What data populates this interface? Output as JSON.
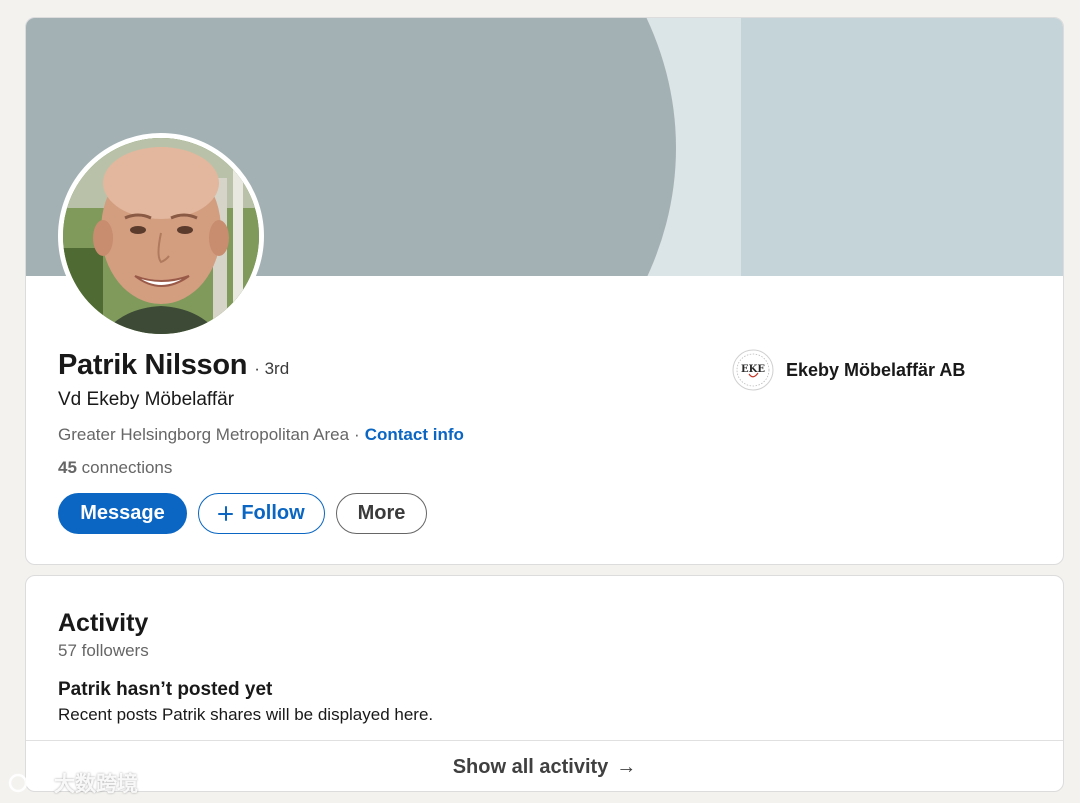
{
  "profile": {
    "name": "Patrik Nilsson",
    "degree": "· 3rd",
    "headline": "Vd Ekeby Möbelaffär",
    "location": "Greater Helsingborg Metropolitan Area",
    "separator": "·",
    "contact_info": "Contact info",
    "connections_count": "45",
    "connections_label": "connections",
    "company_name": "Ekeby Möbelaffär AB",
    "company_logo_text": "EKE"
  },
  "actions": {
    "message_label": "Message",
    "follow_label": "Follow",
    "more_label": "More"
  },
  "activity": {
    "title": "Activity",
    "followers": "57 followers",
    "empty_title": "Patrik hasn’t posted yet",
    "empty_subtitle": "Recent posts Patrik shares will be displayed here.",
    "show_all": "Show all activity",
    "arrow": "→"
  },
  "watermark": {
    "text": "大数跨境"
  },
  "colors": {
    "accent": "#0a66c2",
    "banner_light": "#c5d4d8",
    "banner_dark": "#a3b1b5",
    "page_bg": "#f3f2ef"
  }
}
